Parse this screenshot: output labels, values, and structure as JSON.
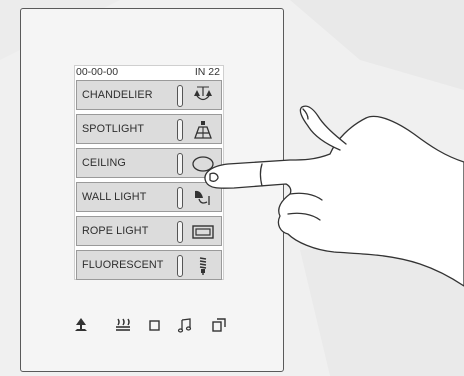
{
  "status": {
    "time": "00-00-00",
    "temperature": "IN 22"
  },
  "lights": [
    {
      "label": "CHANDELIER",
      "icon": "chandelier-icon"
    },
    {
      "label": "SPOTLIGHT",
      "icon": "spotlight-icon"
    },
    {
      "label": "CEILING",
      "icon": "ceiling-light-icon"
    },
    {
      "label": "WALL LIGHT",
      "icon": "wall-light-icon"
    },
    {
      "label": "ROPE LIGHT",
      "icon": "rope-light-icon"
    },
    {
      "label": "FLUORESCENT",
      "icon": "fluorescent-bulb-icon"
    }
  ],
  "bottom_bar": [
    "lamp-icon",
    "heating-icon",
    "blinds-icon",
    "music-note-icon",
    "window-icon"
  ],
  "colors": {
    "panel": "#f5f5f5",
    "row": "#dcdcdc",
    "icon": "#333333",
    "frame": "#5a5a5a"
  }
}
